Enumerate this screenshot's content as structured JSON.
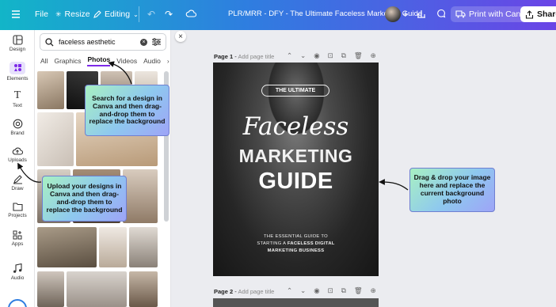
{
  "topbar": {
    "menu_icon": "hamburger-icon",
    "file": "File",
    "resize": "Resize",
    "editing": "Editing",
    "doc_title": "PLR/MRR - DFY - The Ultimate Faceless Marketing Guide",
    "print": "Print with Canva",
    "share": "Share"
  },
  "rail": [
    {
      "label": "Design",
      "icon": "layout-icon"
    },
    {
      "label": "Elements",
      "icon": "elements-icon"
    },
    {
      "label": "Text",
      "icon": "text-icon"
    },
    {
      "label": "Brand",
      "icon": "brand-icon"
    },
    {
      "label": "Uploads",
      "icon": "upload-icon"
    },
    {
      "label": "Draw",
      "icon": "draw-icon"
    },
    {
      "label": "Projects",
      "icon": "folder-icon"
    },
    {
      "label": "Apps",
      "icon": "apps-icon"
    },
    {
      "label": "Audio",
      "icon": "music-icon"
    }
  ],
  "panel": {
    "search_value": "faceless aesthetic",
    "tabs": [
      "All",
      "Graphics",
      "Photos",
      "Videos",
      "Audio"
    ],
    "active_tab": "Photos"
  },
  "page1": {
    "label": "Page 1",
    "title_placeholder": "Add page title",
    "design": {
      "pill": "THE ULTIMATE",
      "script": "Faceless",
      "big1": "MARKETING",
      "big2": "GUIDE",
      "sub1": "THE ESSENTIAL GUIDE TO",
      "sub2_a": "STARTING A ",
      "sub2_b": "FACELESS DIGITAL",
      "sub3": "MARKETING BUSINESS"
    }
  },
  "page2": {
    "label": "Page 2",
    "title_placeholder": "Add page title"
  },
  "callouts": {
    "search": "Search for a design in Canva and then drag-and-drop them to replace the background",
    "upload": "Upload your designs in Canva and then drag-and-drop them to replace the background",
    "drag": "Drag & drop your image here and replace the current background photo"
  },
  "colors": {
    "accent": "#7d2ae8",
    "topbar_start": "#12b5c8",
    "topbar_end": "#6a45e6"
  }
}
